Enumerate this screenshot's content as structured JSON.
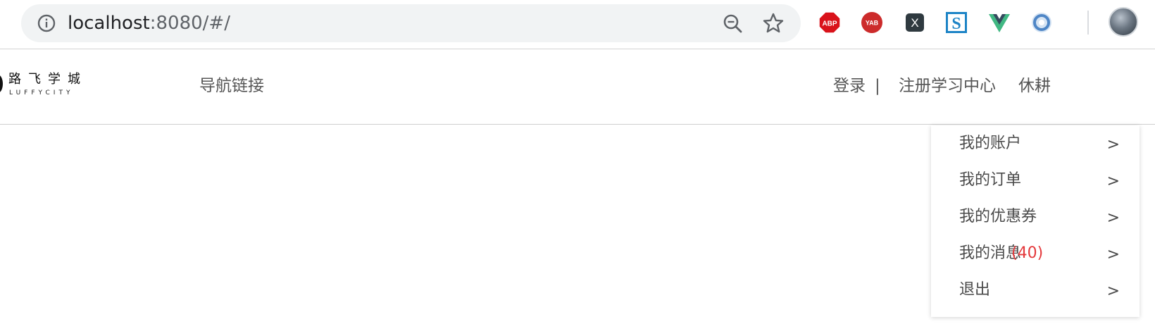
{
  "browser": {
    "url_host": "localhost",
    "url_rest": ":8080/#/",
    "extensions": [
      "adblock-plus-icon",
      "yab-icon",
      "x-extension-icon",
      "s-extension-icon",
      "vue-devtools-icon",
      "circle-extension-icon"
    ],
    "extension_labels": {
      "abp": "ABP",
      "yab": "YAB",
      "x": "X",
      "s": "S"
    }
  },
  "header": {
    "logo_cn": "路飞学城",
    "logo_en": "LUFFYCITY",
    "nav_link": "导航链接",
    "login": "登录",
    "separator": "|",
    "register": "注册学习中心",
    "rest": "休耕"
  },
  "dropdown": {
    "items": [
      {
        "label": "我的账户",
        "count": "",
        "arrow": ">"
      },
      {
        "label": "我的订单",
        "count": "",
        "arrow": ">"
      },
      {
        "label": "我的优惠券",
        "count": "",
        "arrow": ">"
      },
      {
        "label": "我的消息",
        "count": "(40)",
        "arrow": ">"
      },
      {
        "label": "退出",
        "count": "",
        "arrow": ">"
      }
    ]
  },
  "colors": {
    "accent_red": "#e4393c",
    "text_gray": "#555555",
    "omnibox_bg": "#f1f3f4"
  }
}
